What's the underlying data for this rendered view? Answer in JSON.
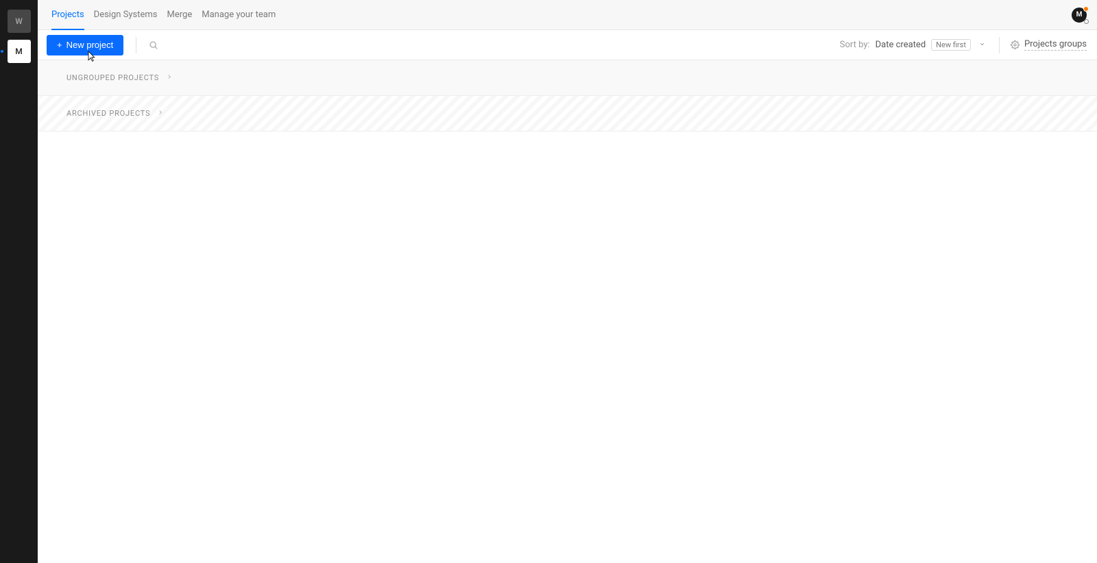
{
  "sidebar": {
    "items": [
      {
        "label": "W"
      },
      {
        "label": "M"
      }
    ]
  },
  "nav": {
    "tabs": [
      {
        "label": "Projects",
        "active": true
      },
      {
        "label": "Design Systems",
        "active": false
      },
      {
        "label": "Merge",
        "active": false
      },
      {
        "label": "Manage your team",
        "active": false
      }
    ],
    "avatar_initial": "M"
  },
  "toolbar": {
    "new_project_label": "New project",
    "sort_by_label": "Sort by:",
    "sort_type": "Date created",
    "sort_order": "New first",
    "projects_groups_label": "Projects groups"
  },
  "sections": {
    "ungrouped_label": "UNGROUPED PROJECTS",
    "archived_label": "ARCHIVED PROJECTS"
  }
}
